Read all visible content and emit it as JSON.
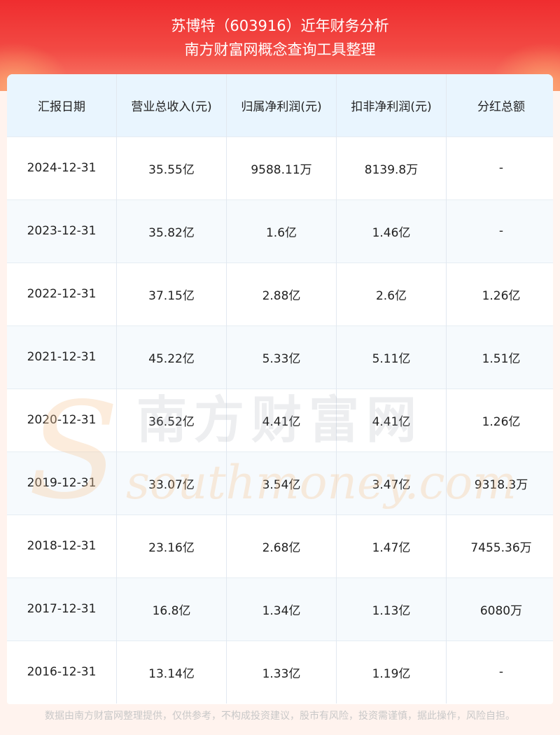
{
  "header": {
    "title": "苏博特（603916）近年财务分析",
    "subtitle": "南方财富网概念查询工具整理"
  },
  "table": {
    "columns": [
      "汇报日期",
      "营业总收入(元)",
      "归属净利润(元)",
      "扣非净利润(元)",
      "分红总额"
    ],
    "rows": [
      [
        "2024-12-31",
        "35.55亿",
        "9588.11万",
        "8139.8万",
        "-"
      ],
      [
        "2023-12-31",
        "35.82亿",
        "1.6亿",
        "1.46亿",
        "-"
      ],
      [
        "2022-12-31",
        "37.15亿",
        "2.88亿",
        "2.6亿",
        "1.26亿"
      ],
      [
        "2021-12-31",
        "45.22亿",
        "5.33亿",
        "5.11亿",
        "1.51亿"
      ],
      [
        "2020-12-31",
        "36.52亿",
        "4.41亿",
        "4.41亿",
        "1.26亿"
      ],
      [
        "2019-12-31",
        "33.07亿",
        "3.54亿",
        "3.47亿",
        "9318.3万"
      ],
      [
        "2018-12-31",
        "23.16亿",
        "2.68亿",
        "1.47亿",
        "7455.36万"
      ],
      [
        "2017-12-31",
        "16.8亿",
        "1.34亿",
        "1.13亿",
        "6080万"
      ],
      [
        "2016-12-31",
        "13.14亿",
        "1.33亿",
        "1.19亿",
        "-"
      ]
    ]
  },
  "watermark": {
    "cn": "南方财富网",
    "en": "southmoney.com"
  },
  "footer": {
    "disclaimer": "数据由南方财富网整理提供，仅供参考，不构成投资建议，股市有风险，投资需谨慎，据此操作，风险自担。"
  },
  "colors": {
    "header_red": "#ef2d2f",
    "table_header_bg": "#e9f5fe",
    "page_bg": "#fff3ee"
  }
}
